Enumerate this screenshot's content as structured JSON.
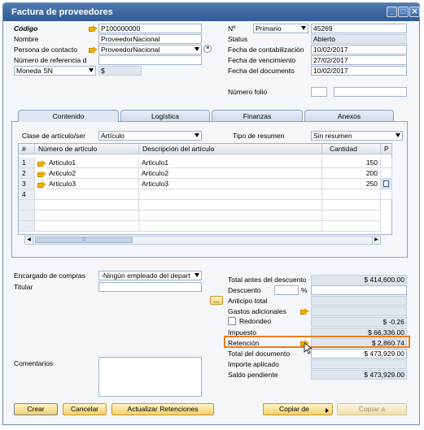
{
  "window": {
    "title": "Factura de proveedores",
    "btn_min": "_",
    "btn_max": "□",
    "btn_close": "✕"
  },
  "header_left": {
    "codigo_label": "Código",
    "codigo_value": "P100000000",
    "nombre_label": "Nombre",
    "nombre_value": "ProveedorNacional",
    "persona_label": "Persona de contacto",
    "persona_value": "ProveedorNacional",
    "numref_label": "Número de referencia d",
    "numref_value": "",
    "moneda_value": "Moneda SN",
    "moneda_symbol": "$"
  },
  "header_right": {
    "no_label": "Nº",
    "no_series": "Primario",
    "no_value": "45269",
    "status_label": "Status",
    "status_value": "Abierto",
    "fcont_label": "Fecha de contabilización",
    "fcont_value": "10/02/2017",
    "fvenc_label": "Fecha de vencimiento",
    "fvenc_value": "27/02/2017",
    "fdoc_label": "Fecha del documento",
    "fdoc_value": "10/02/2017",
    "folio_label": "Número folio",
    "folio_prefix": "",
    "folio_value": ""
  },
  "tabs": [
    "Contenido",
    "Logística",
    "Finanzas",
    "Anexos"
  ],
  "content": {
    "clase_label": "Clase de artículo/ser",
    "clase_value": "Artículo",
    "resumen_label": "Tipo de resumen",
    "resumen_value": "Sin resumen"
  },
  "grid": {
    "columns": [
      "#",
      "Número de artículo",
      "Descripción del artículo",
      "Cantidad",
      "P"
    ],
    "rows": [
      {
        "n": "1",
        "item": "Articulo1",
        "desc": "Articulo1",
        "qty": "150"
      },
      {
        "n": "2",
        "item": "Articulo2",
        "desc": "Articulo2",
        "qty": "200"
      },
      {
        "n": "3",
        "item": "Articulo3",
        "desc": "Articulo3",
        "qty": "250"
      },
      {
        "n": "4",
        "item": "",
        "desc": "",
        "qty": ""
      }
    ],
    "scroll_grip": ":::"
  },
  "footer_left": {
    "encargado_label": "Encargado de compras",
    "encargado_value": "-Ningún empleado del depart",
    "titular_label": "Titular",
    "titular_value": "",
    "comentarios_label": "Comentarios",
    "comentarios_value": ""
  },
  "totals": {
    "total_antes_label": "Total antes del descuento",
    "total_antes_value": "$ 414,600.00",
    "descuento_label": "Descuento",
    "descuento_pct_symbol": "%",
    "descuento_value": "",
    "anticipo_btn": "...",
    "anticipo_label": "Anticipo total",
    "anticipo_value": "",
    "gastos_label": "Gastos adicionales",
    "gastos_value": "",
    "redondeo_label": "Redondeo",
    "redondeo_value": "$ -0.26",
    "impuesto_label": "Impuesto",
    "impuesto_value": "$ 66,336.00",
    "retencion_label": "Retención",
    "retencion_value": "$ 2,860.74",
    "total_doc_label": "Total del documento",
    "total_doc_value": "$ 473,929.00",
    "importe_label": "Importe aplicado",
    "importe_value": "",
    "saldo_label": "Saldo pendiente",
    "saldo_value": "$ 473,929.00"
  },
  "buttons": {
    "crear": "Crear",
    "cancelar": "Cancelar",
    "actualizar": "Actualizar Retenciones",
    "copiar_de": "Copiar de",
    "copiar_a": "Copiar a"
  },
  "colors": {
    "titlebar": "#2f5a96",
    "highlight": "#f07c1c",
    "button": "#f4cf6b"
  }
}
